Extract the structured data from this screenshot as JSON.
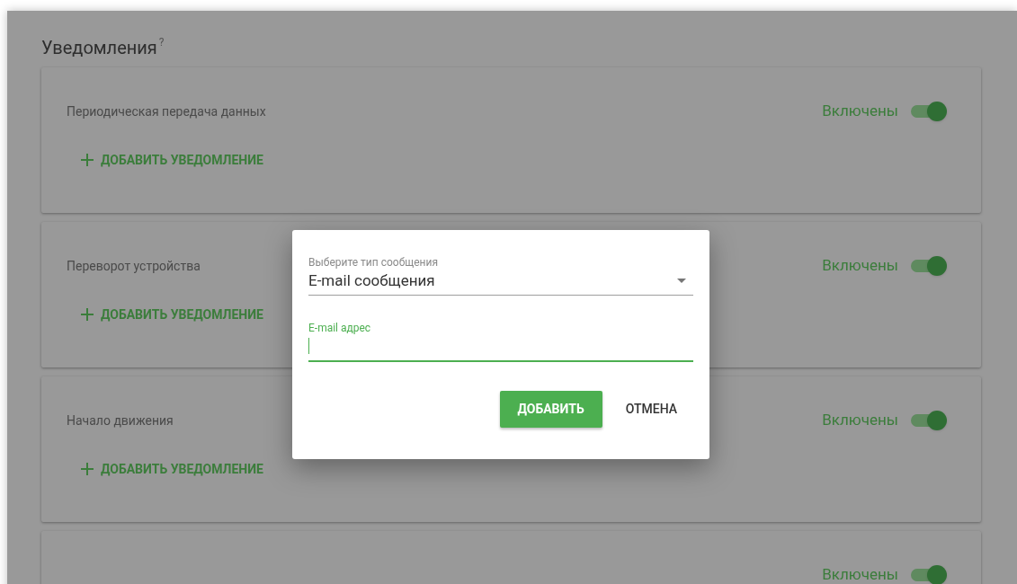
{
  "page": {
    "title": "Уведомления",
    "help_mark": "?"
  },
  "notification_groups": [
    {
      "name": "Периодическая передача данных",
      "status": "Включены",
      "on": true,
      "add_button": "ДОБАВИТЬ УВЕДОМЛЕНИЕ"
    },
    {
      "name": "Переворот устройства",
      "status": "Включены",
      "on": true,
      "add_button": "ДОБАВИТЬ УВЕДОМЛЕНИЕ"
    },
    {
      "name": "Начало движения",
      "status": "Включены",
      "on": true,
      "add_button": "ДОБАВИТЬ УВЕДОМЛЕНИЕ"
    },
    {
      "status": "Включены",
      "on": true
    }
  ],
  "dialog": {
    "type_select": {
      "label": "Выберите тип сообщения",
      "value": "E-mail сообщения"
    },
    "email_field": {
      "label": "E-mail адрес",
      "focused": true
    },
    "buttons": [
      {
        "label": "ДОБАВИТЬ",
        "kind": "primary"
      },
      {
        "label": "ОТМЕНА",
        "kind": "text"
      }
    ]
  }
}
